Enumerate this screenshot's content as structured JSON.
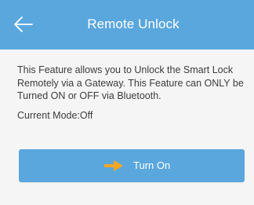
{
  "header": {
    "title": "Remote Unlock",
    "back_icon": "arrow-left-icon",
    "color": "#5aa7de"
  },
  "content": {
    "description": "This Feature allows you to Unlock the Smart Lock Remotely via a Gateway. This Feature can ONLY be Turned ON or OFF via Bluetooth.",
    "current_mode": "Current Mode:Off"
  },
  "action": {
    "label": "Turn On",
    "icon": "orange-arrow-right-icon",
    "icon_color": "#f5a623",
    "button_color": "#5aa7de"
  }
}
